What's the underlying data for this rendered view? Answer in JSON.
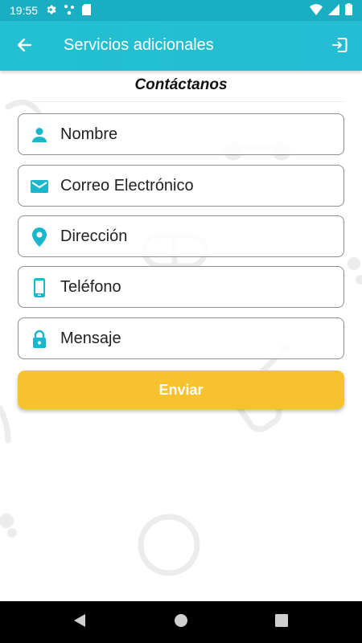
{
  "status_bar": {
    "time": "19:55"
  },
  "app_bar": {
    "title": "Servicios adicionales"
  },
  "page": {
    "title": "Contáctanos"
  },
  "form": {
    "fields": [
      {
        "icon": "person-icon",
        "placeholder": "Nombre"
      },
      {
        "icon": "email-icon",
        "placeholder": "Correo Electrónico"
      },
      {
        "icon": "location-pin-icon",
        "placeholder": "Dirección"
      },
      {
        "icon": "phone-icon",
        "placeholder": "Teléfono"
      },
      {
        "icon": "lock-icon",
        "placeholder": "Mensaje"
      }
    ],
    "submit_label": "Enviar"
  },
  "colors": {
    "primary": "#22c0d0",
    "accent": "#f8c22f",
    "icon": "#1ab6cc"
  }
}
